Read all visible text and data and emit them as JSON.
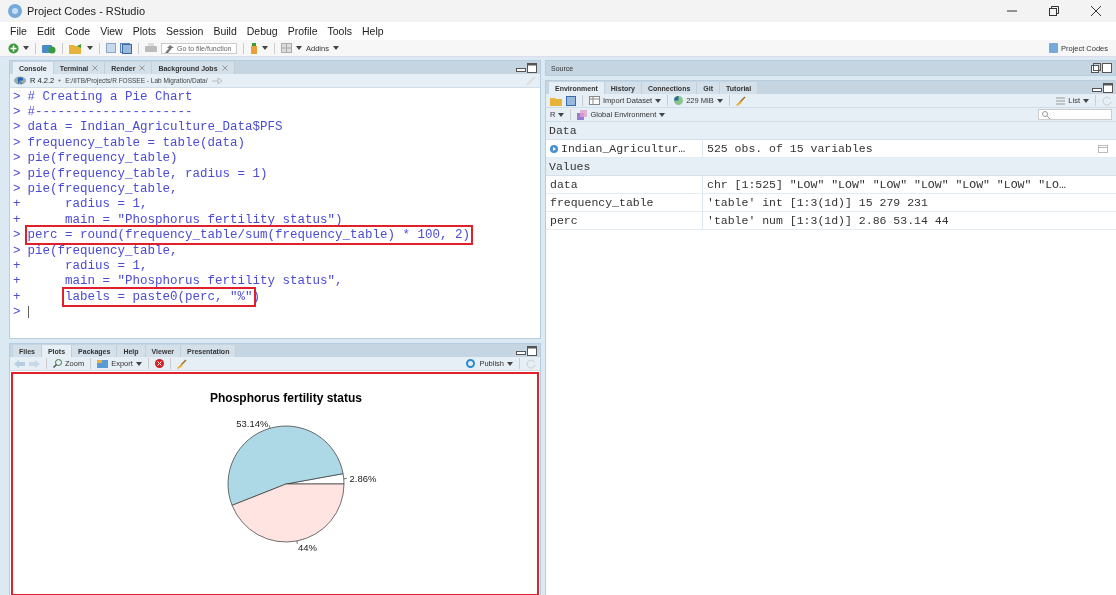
{
  "window": {
    "title": "Project Codes - RStudio"
  },
  "menu": [
    "File",
    "Edit",
    "Code",
    "View",
    "Plots",
    "Session",
    "Build",
    "Debug",
    "Profile",
    "Tools",
    "Help"
  ],
  "toolbar": {
    "goto_placeholder": "Go to file/function",
    "addins": "Addins",
    "project": "Project Codes"
  },
  "console_pane": {
    "tabs": [
      {
        "label": "Console",
        "closable": false,
        "selected": true
      },
      {
        "label": "Terminal",
        "closable": true,
        "selected": false
      },
      {
        "label": "Render",
        "closable": true,
        "selected": false
      },
      {
        "label": "Background Jobs",
        "closable": true,
        "selected": false
      }
    ],
    "r_version": "R 4.2.2",
    "path": "E:/IITB/Projects/R FOSSEE - Lab Migration/Data/",
    "lines": [
      {
        "prompt": ">",
        "segments": [
          {
            "text": "# Creating a Pie Chart",
            "highlighted": false
          }
        ]
      },
      {
        "prompt": ">",
        "segments": [
          {
            "text": "#---------------------",
            "highlighted": false
          }
        ]
      },
      {
        "prompt": ">",
        "segments": [
          {
            "text": "data = Indian_Agriculture_Data$PFS",
            "highlighted": false
          }
        ]
      },
      {
        "prompt": ">",
        "segments": [
          {
            "text": "frequency_table = table(data)",
            "highlighted": false
          }
        ]
      },
      {
        "prompt": ">",
        "segments": [
          {
            "text": "pie(frequency_table)",
            "highlighted": false
          }
        ]
      },
      {
        "prompt": ">",
        "segments": [
          {
            "text": "pie(frequency_table, radius = 1)",
            "highlighted": false
          }
        ]
      },
      {
        "prompt": ">",
        "segments": [
          {
            "text": "pie(frequency_table,",
            "highlighted": false
          }
        ]
      },
      {
        "prompt": "+",
        "segments": [
          {
            "text": "     radius = 1,",
            "highlighted": false
          }
        ]
      },
      {
        "prompt": "+",
        "segments": [
          {
            "text": "     main = \"Phosphorus fertility status\")",
            "highlighted": false
          }
        ]
      },
      {
        "prompt": ">",
        "segments": [
          {
            "text": "perc = round(frequency_table/sum(frequency_table) * 100, 2)",
            "highlighted": true
          }
        ]
      },
      {
        "prompt": ">",
        "segments": [
          {
            "text": "pie(frequency_table,",
            "highlighted": false
          }
        ]
      },
      {
        "prompt": "+",
        "segments": [
          {
            "text": "     radius = 1,",
            "highlighted": false
          }
        ]
      },
      {
        "prompt": "+",
        "segments": [
          {
            "text": "     main = \"Phosphorus fertility status\",",
            "highlighted": false
          }
        ]
      },
      {
        "prompt": "+",
        "segments": [
          {
            "text": "     labels = paste0(perc, \"%\"",
            "highlighted": true
          },
          {
            "text": ")",
            "highlighted": false
          }
        ]
      },
      {
        "prompt": ">"
      }
    ]
  },
  "plots_pane": {
    "tabs": [
      {
        "label": "Files",
        "selected": false
      },
      {
        "label": "Plots",
        "selected": true
      },
      {
        "label": "Packages",
        "selected": false
      },
      {
        "label": "Help",
        "selected": false
      },
      {
        "label": "Viewer",
        "selected": false
      },
      {
        "label": "Presentation",
        "selected": false
      }
    ],
    "zoom": "Zoom",
    "export": "Export",
    "publish": "Publish",
    "highlighted": true,
    "chart_data": {
      "type": "pie",
      "title": "Phosphorus fertility status",
      "values": [
        2.86,
        53.14,
        44
      ],
      "value_labels": [
        "2.86%",
        "53.14%",
        "44%"
      ]
    }
  },
  "source_pane": {
    "title": "Source"
  },
  "env_pane": {
    "tabs": [
      {
        "label": "Environment",
        "selected": true
      },
      {
        "label": "History",
        "selected": false
      },
      {
        "label": "Connections",
        "selected": false
      },
      {
        "label": "Git",
        "selected": false
      },
      {
        "label": "Tutorial",
        "selected": false
      }
    ],
    "import_dataset": "Import Dataset",
    "memory": "229 MiB",
    "view": "List",
    "language": "R",
    "environment": "Global Environment",
    "sections": [
      {
        "title": "Data",
        "rows": [
          {
            "kind": "dataset",
            "name": "Indian_Agricultur…",
            "value": "525 obs. of 15 variables"
          }
        ]
      },
      {
        "title": "Values",
        "rows": [
          {
            "kind": "value",
            "name": "data",
            "value": "chr [1:525] \"LOW\" \"LOW\" \"LOW\" \"LOW\" \"LOW\" \"LOW\" \"LO…"
          },
          {
            "kind": "value",
            "name": "frequency_table",
            "value": "'table' int [1:3(1d)] 15 279 231"
          },
          {
            "kind": "value",
            "name": "perc",
            "value": "'table' num [1:3(1d)] 2.86 53.14 44"
          }
        ]
      }
    ]
  }
}
